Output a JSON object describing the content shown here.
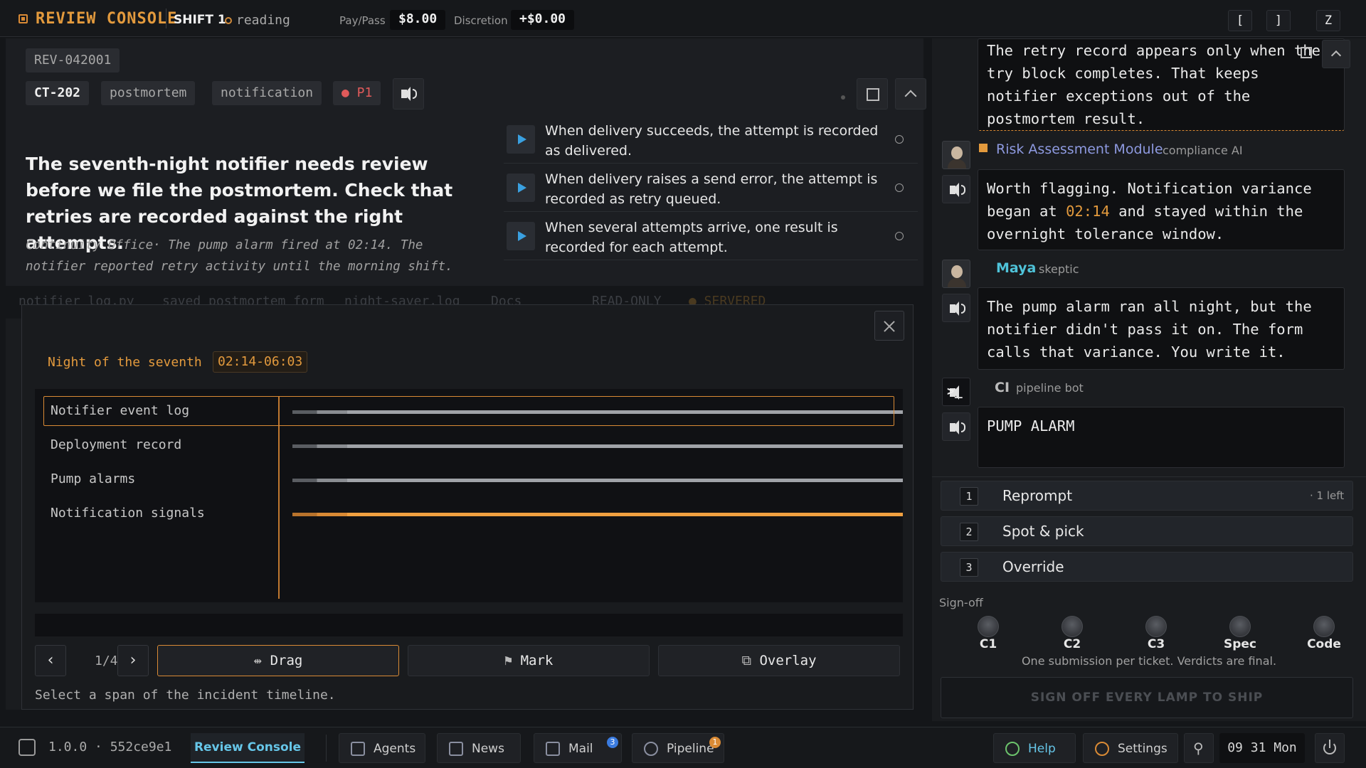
{
  "topbar": {
    "brand": "REVIEW CONSOLE",
    "shift": "SHIFT 1",
    "status": "reading",
    "pay_label": "Pay/Pass",
    "pay_value": "$8.00",
    "discretion_label": "Discretion",
    "discretion_value": "+$0.00",
    "keys": [
      "[",
      "]",
      "Z"
    ]
  },
  "ticket": {
    "id": "REV-042001",
    "tags": [
      "CT-202",
      "postmortem",
      "notification"
    ],
    "priority": "● P1",
    "heading": "The seventh-night notifier needs review before we file the postmortem. Check that retries are recorded against the right attempts.",
    "subtext": "Continuity Office· The pump alarm fired at 02:14. The notifier reported retry activity until the morning shift.",
    "criteria": [
      "When delivery succeeds, the attempt is recorded as delivered.",
      "When delivery raises a send error, the attempt is recorded as retry queued.",
      "When several attempts arrive, one result is recorded for each attempt."
    ]
  },
  "behind_tabs": [
    "notifier_log.py",
    "saved_postmortem_form",
    "night-saver.log",
    "Docs",
    "READ-ONLY",
    "● SERVERED"
  ],
  "modal": {
    "night_label": "Night of the seventh",
    "time_range": "02:14-06:03",
    "rows": [
      "Notifier event log",
      "Deployment record",
      "Pump alarms",
      "Notification signals"
    ],
    "page": "1/4",
    "tools": {
      "drag": "Drag",
      "mark": "Mark",
      "overlay": "Overlay"
    },
    "hint": "Select a span of the incident timeline."
  },
  "chat": {
    "top_bubble": "The retry record appears only when the try block completes. That keeps notifier exceptions out of the postmortem result.",
    "messages": [
      {
        "name": "Risk Assessment Module",
        "role": "compliance AI",
        "pre": "Worth flagging. Notification variance began at ",
        "highlight": "02:14",
        "post": " and stayed within the overnight tolerance window.",
        "color": "#8e9ae0"
      },
      {
        "name": "Maya",
        "role": "skeptic",
        "text": "The pump alarm ran all night, but the notifier didn't pass it on. The form calls that variance. You write it.",
        "color": "#4fc3d9"
      },
      {
        "name": "CI",
        "role": "pipeline bot",
        "text": "PUMP ALARM",
        "color": "#bbbbbb"
      }
    ]
  },
  "actions": [
    {
      "num": "1",
      "label": "Reprompt",
      "extra": "· 1 left"
    },
    {
      "num": "2",
      "label": "Spot & pick",
      "extra": ""
    },
    {
      "num": "3",
      "label": "Override",
      "extra": ""
    }
  ],
  "signoff": {
    "title": "Sign-off",
    "lamps": [
      "C1",
      "C2",
      "C3",
      "Spec",
      "Code"
    ],
    "note": "One submission per ticket. Verdicts are final.",
    "ship": "SIGN OFF EVERY LAMP TO SHIP"
  },
  "taskbar": {
    "version": "1.0.0 · 552ce9e1",
    "active": "Review Console",
    "agents": "Agents",
    "news": "News",
    "mail": "Mail",
    "mail_badge": "3",
    "pipeline": "Pipeline",
    "pipeline_badge": "1",
    "help": "Help",
    "settings": "Settings",
    "clock": "09 31 Mon"
  },
  "colors": {
    "accent": "#d98a35",
    "blue": "#3aa0e0",
    "danger": "#e05a5a"
  }
}
